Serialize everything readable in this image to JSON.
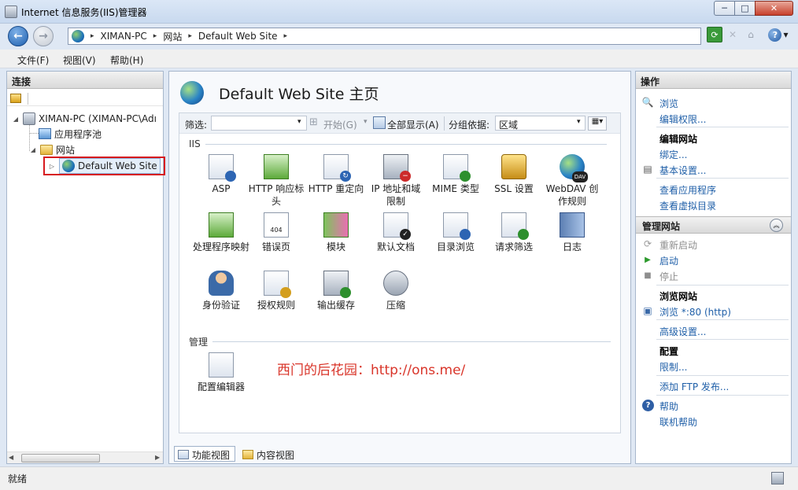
{
  "window": {
    "title": "Internet 信息服务(IIS)管理器",
    "min_glyph": "─",
    "max_glyph": "□",
    "close_glyph": "✕"
  },
  "address": {
    "back_glyph": "←",
    "forward_glyph": "→",
    "breadcrumbs": [
      "XIMAN-PC",
      "网站",
      "Default Web Site"
    ],
    "separator_glyph": "▸",
    "refresh_glyph": "⟳",
    "stop_glyph": "✕",
    "home_glyph": "⌂",
    "help_glyph": "?",
    "help_arrow": "▾"
  },
  "menu": {
    "file": "文件(F)",
    "view": "视图(V)",
    "help": "帮助(H)"
  },
  "left": {
    "header": "连接",
    "tree": {
      "root": "XIMAN-PC (XIMAN-PC\\Adı",
      "app_pools": "应用程序池",
      "sites": "网站",
      "site": "Default Web Site",
      "expanded_glyph": "◢",
      "collapsed_glyph": "▷"
    },
    "scroll_left": "◀",
    "scroll_right": "▶"
  },
  "center": {
    "page_title": "Default Web Site 主页",
    "filter": {
      "label": "筛选:",
      "value": "",
      "dropdown_glyph": "▾",
      "start_glyph": "⊞",
      "start_label": "开始(G)",
      "show_all_label": "全部显示(A)",
      "group_by_label": "分组依据:",
      "group_by_value": "区域",
      "view_glyph": "▦▾"
    },
    "groups": {
      "iis": "IIS",
      "manage": "管理"
    },
    "features": {
      "asp": "ASP",
      "headers": "HTTP 响应标头",
      "redirect": "HTTP 重定向",
      "ip": "IP 地址和域限制",
      "mime": "MIME 类型",
      "ssl": "SSL 设置",
      "webdav": "WebDAV 创作规则",
      "handlers": "处理程序映射",
      "errors": "错误页",
      "modules": "模块",
      "default_doc": "默认文档",
      "dir_browse": "目录浏览",
      "req_filter": "请求筛选",
      "logging": "日志",
      "auth": "身份验证",
      "authz": "授权规则",
      "cache": "输出缓存",
      "compress": "压缩",
      "config": "配置编辑器"
    },
    "badges": {
      "error_code": "404",
      "webdav": "DAV",
      "ip_block": "−",
      "default_doc": "✓",
      "redirect": "↻"
    },
    "watermark": "西门的后花园：http://ons.me/",
    "tabs": {
      "features_view": "功能视图",
      "content_view": "内容视图"
    }
  },
  "right": {
    "header": "操作",
    "actions": {
      "browse": "浏览",
      "edit_perms": "编辑权限...",
      "edit_site_head": "编辑网站",
      "bindings": "绑定...",
      "basic_settings": "基本设置...",
      "view_apps": "查看应用程序",
      "view_vdirs": "查看虚拟目录",
      "manage_site_head": "管理网站",
      "restart": "重新启动",
      "start": "启动",
      "stop": "停止",
      "browse_site_head": "浏览网站",
      "browse_80": "浏览 *:80 (http)",
      "advanced": "高级设置...",
      "config_head": "配置",
      "limits": "限制...",
      "add_ftp": "添加 FTP 发布...",
      "help": "帮助",
      "online_help": "联机帮助"
    },
    "icons": {
      "browse": "🔍",
      "basic": "▤",
      "restart": "⟳",
      "start": "▶",
      "stop": "■",
      "browse_80": "▣",
      "help": "?"
    },
    "collapse_glyph": "︽"
  },
  "status": {
    "text": "就绪"
  },
  "colors": {
    "link": "#1f5fa8",
    "watermark": "#d9352a",
    "selection_outline": "#d7191e"
  }
}
